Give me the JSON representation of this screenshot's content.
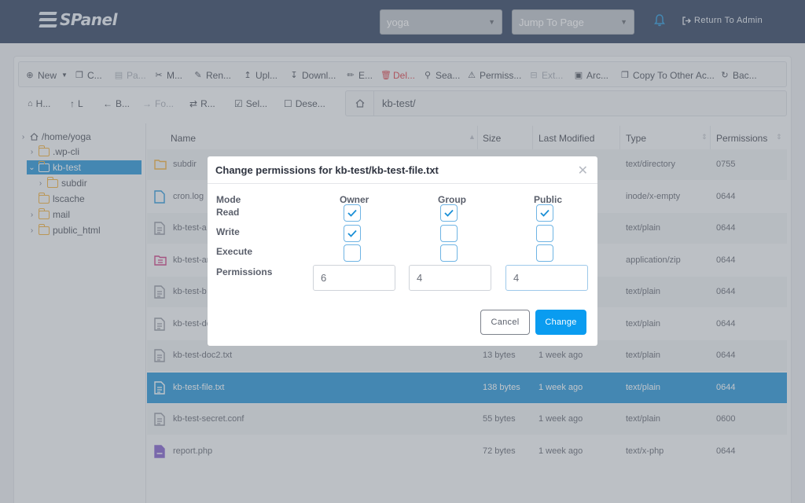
{
  "app": {
    "logo_text": "SPanel"
  },
  "topbar": {
    "account_select": "yoga",
    "jump_select": "Jump To Page",
    "return_label": "Return To Admin"
  },
  "toolbar": {
    "new": "New",
    "copy": "C...",
    "paste": "Pa...",
    "move": "M...",
    "rename": "Ren...",
    "upload": "Upl...",
    "download": "Downl...",
    "edit": "E...",
    "delete": "Del...",
    "search": "Sea...",
    "permissions": "Permiss...",
    "extract": "Ext...",
    "archive": "Arc...",
    "copy_other": "Copy To Other Ac...",
    "backup": "Bac..."
  },
  "nav": {
    "home": "H...",
    "up": "L",
    "back": "B...",
    "forward": "Fo...",
    "reload": "R...",
    "select": "Sel...",
    "deselect": "Dese..."
  },
  "path": "kb-test/",
  "tree": [
    {
      "label": "/home/yoga"
    },
    {
      "label": ".wp-cli"
    },
    {
      "label": "kb-test"
    },
    {
      "label": "subdir"
    },
    {
      "label": "lscache"
    },
    {
      "label": "mail"
    },
    {
      "label": "public_html"
    }
  ],
  "table": {
    "headers": {
      "name": "Name",
      "size": "Size",
      "modified": "Last Modified",
      "type": "Type",
      "permissions": "Permissions"
    },
    "rows": [
      {
        "name": "subdir",
        "size": "",
        "modified": "",
        "type": "text/directory",
        "perm": "0755"
      },
      {
        "name": "cron.log",
        "size": "",
        "modified": "",
        "type": "inode/x-empty",
        "perm": "0644"
      },
      {
        "name": "kb-test-a",
        "size": "",
        "modified": "",
        "type": "text/plain",
        "perm": "0644"
      },
      {
        "name": "kb-test-ar",
        "size": "",
        "modified": "",
        "type": "application/zip",
        "perm": "0644"
      },
      {
        "name": "kb-test-b",
        "size": "",
        "modified": "",
        "type": "text/plain",
        "perm": "0644"
      },
      {
        "name": "kb-test-do",
        "size": "",
        "modified": "",
        "type": "text/plain",
        "perm": "0644"
      },
      {
        "name": "kb-test-doc2.txt",
        "size": "13 bytes",
        "modified": "1 week ago",
        "type": "text/plain",
        "perm": "0644"
      },
      {
        "name": "kb-test-file.txt",
        "size": "138 bytes",
        "modified": "1 week ago",
        "type": "text/plain",
        "perm": "0644"
      },
      {
        "name": "kb-test-secret.conf",
        "size": "55 bytes",
        "modified": "1 week ago",
        "type": "text/plain",
        "perm": "0600"
      },
      {
        "name": "report.php",
        "size": "72 bytes",
        "modified": "1 week ago",
        "type": "text/x-php",
        "perm": "0644"
      }
    ]
  },
  "modal": {
    "title": "Change permissions for kb-test/kb-test-file.txt",
    "mode_label": "Mode",
    "owner_label": "Owner",
    "group_label": "Group",
    "public_label": "Public",
    "read_label": "Read",
    "write_label": "Write",
    "execute_label": "Execute",
    "permissions_label": "Permissions",
    "owner_value": "6",
    "group_value": "4",
    "public_value": "4",
    "cancel_label": "Cancel",
    "change_label": "Change",
    "checks": {
      "read": [
        true,
        true,
        true
      ],
      "write": [
        true,
        false,
        false
      ],
      "execute": [
        false,
        false,
        false
      ]
    }
  },
  "colors": {
    "accent": "#1a8fd6",
    "topbar": "#243656",
    "folder": "#f0a92e"
  }
}
